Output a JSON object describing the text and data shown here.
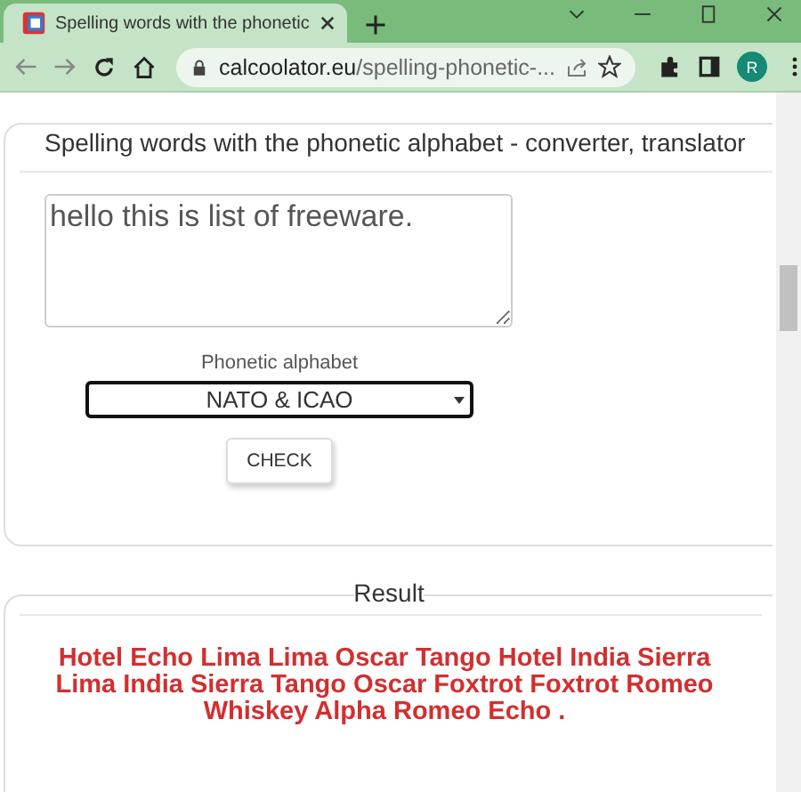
{
  "browser": {
    "tab_title": "Spelling words with the phonetic",
    "url_host": "calcoolator.eu",
    "url_path": "/spelling-phonetic-...",
    "profile_initial": "R"
  },
  "converter": {
    "title": "Spelling words with the phonetic alphabet - converter, translator",
    "input_value": "hello this is list of freeware.",
    "select_label": "Phonetic alphabet",
    "select_value": "NATO & ICAO",
    "button": "CHECK"
  },
  "result": {
    "title": "Result",
    "lines": [
      "Hotel Echo Lima Lima Oscar Tango Hotel India Sierra",
      "Lima India Sierra Tango Oscar Foxtrot Foxtrot Romeo",
      "Whiskey Alpha Romeo Echo ."
    ]
  }
}
